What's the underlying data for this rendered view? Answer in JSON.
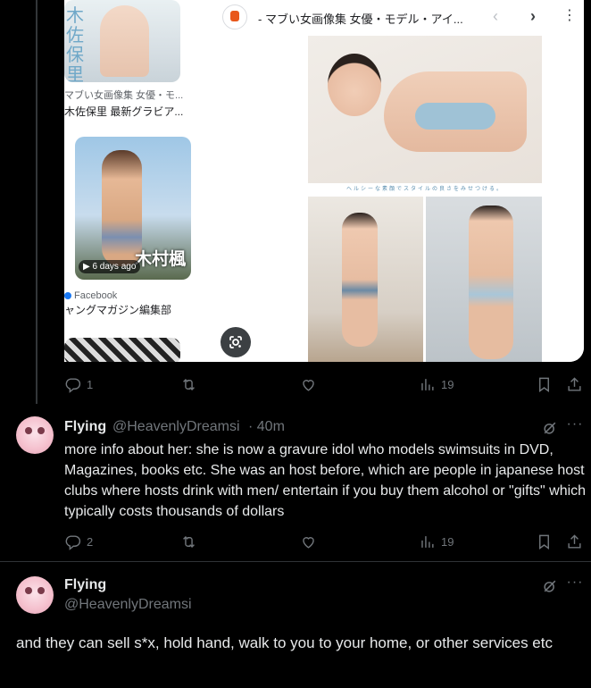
{
  "embed": {
    "left_items": [
      {
        "kanji": "木佐保里",
        "site": "マブい女画像集 女優・モ...",
        "title": "木佐保里 最新グラビア..."
      },
      {
        "overlay_name": "木村楓",
        "badge": "6 days ago",
        "site": "Facebook",
        "title": "ャングマガジン編集部"
      }
    ],
    "viewer": {
      "site_title": "- マブい女画像集 女優・モデル・アイ...",
      "photo_caption": "ヘルシーな素顔でスタイルの良さをみせつける。"
    }
  },
  "first_actions": {
    "reply": "1",
    "views": "19"
  },
  "reply1": {
    "name": "Flying",
    "handle": "@HeavenlyDreamsi",
    "time": "· 40m",
    "text": "more info about her: she is now a gravure idol who models swimsuits in DVD, Magazines, books etc.  She was an host before, which are people in japanese host clubs where hosts drink with men/ entertain if you buy them alcohol or \"gifts\" which typically costs thousands of dollars",
    "replies": "2",
    "views": "19"
  },
  "reply2": {
    "name": "Flying",
    "handle": "@HeavenlyDreamsi",
    "text": "and they can sell s*x, hold hand, walk to you to your home, or other services etc"
  },
  "icons": [
    "reply-icon",
    "retweet-icon",
    "like-icon",
    "views-icon",
    "bookmark-icon",
    "share-icon",
    "grok-icon",
    "more-icon",
    "lens-icon"
  ],
  "colors": {
    "background": "#000000",
    "text": "#e7e9ea",
    "muted": "#71767b",
    "divider": "#2f3336"
  }
}
